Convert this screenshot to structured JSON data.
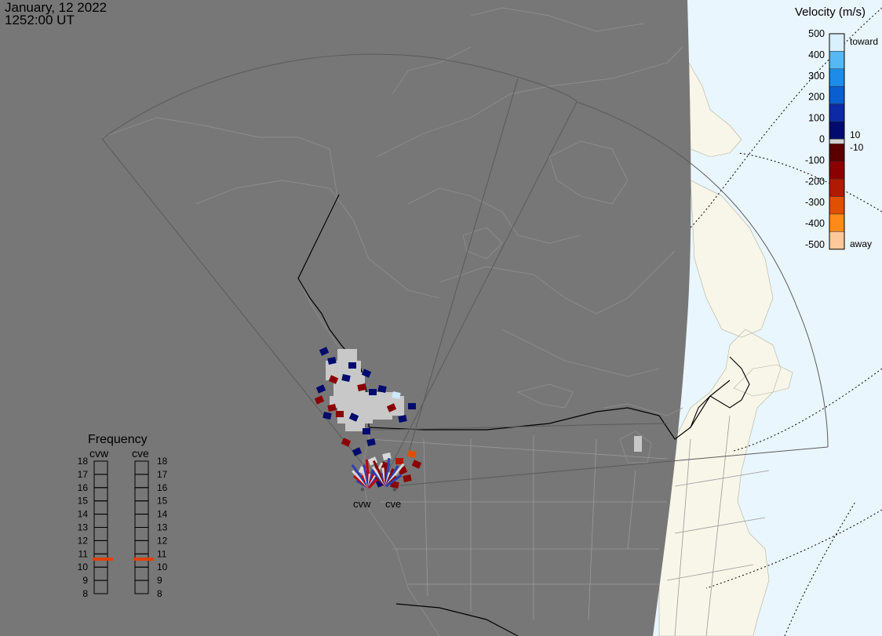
{
  "header": {
    "date": "January, 12 2022",
    "time": "1252:00 UT"
  },
  "colorbar": {
    "title": "Velocity (m/s)",
    "ticks": [
      "500",
      "400",
      "300",
      "200",
      "100",
      "0",
      "-100",
      "-200",
      "-300",
      "-400",
      "-500"
    ],
    "label_toward": "toward",
    "label_away": "away",
    "label_pos10": "10",
    "label_neg10": "-10",
    "colors": [
      "#d8f0ff",
      "#56b8f5",
      "#1c8ce8",
      "#0a5ecf",
      "#0c2aa5",
      "#000b6e",
      "#5a0000",
      "#8b0000",
      "#b01a00",
      "#e05000",
      "#ff8a1a",
      "#ffc89a"
    ]
  },
  "radars": [
    {
      "name": "cvw",
      "beam_colors": [
        "#2f3eb0",
        "#c00000",
        "#d8d8d8"
      ]
    },
    {
      "name": "cve",
      "beam_colors": [
        "#8b0000",
        "#2f3eb0",
        "#d8d8d8"
      ]
    }
  ],
  "frequency": {
    "title": "Frequency",
    "radars": [
      "cvw",
      "cve"
    ],
    "mhz_scale": [
      "18",
      "17",
      "16",
      "15",
      "14",
      "13",
      "12",
      "11",
      "10",
      "9",
      "8"
    ],
    "current_mhz": {
      "cvw": 10.6,
      "cve": 10.6
    },
    "marker_color": "#e0400a"
  },
  "colors": {
    "night": "#777777",
    "ocean": "#eaf6fd",
    "land_day": "#f8f6e8",
    "ground_scatter": "#c8c8c8"
  }
}
